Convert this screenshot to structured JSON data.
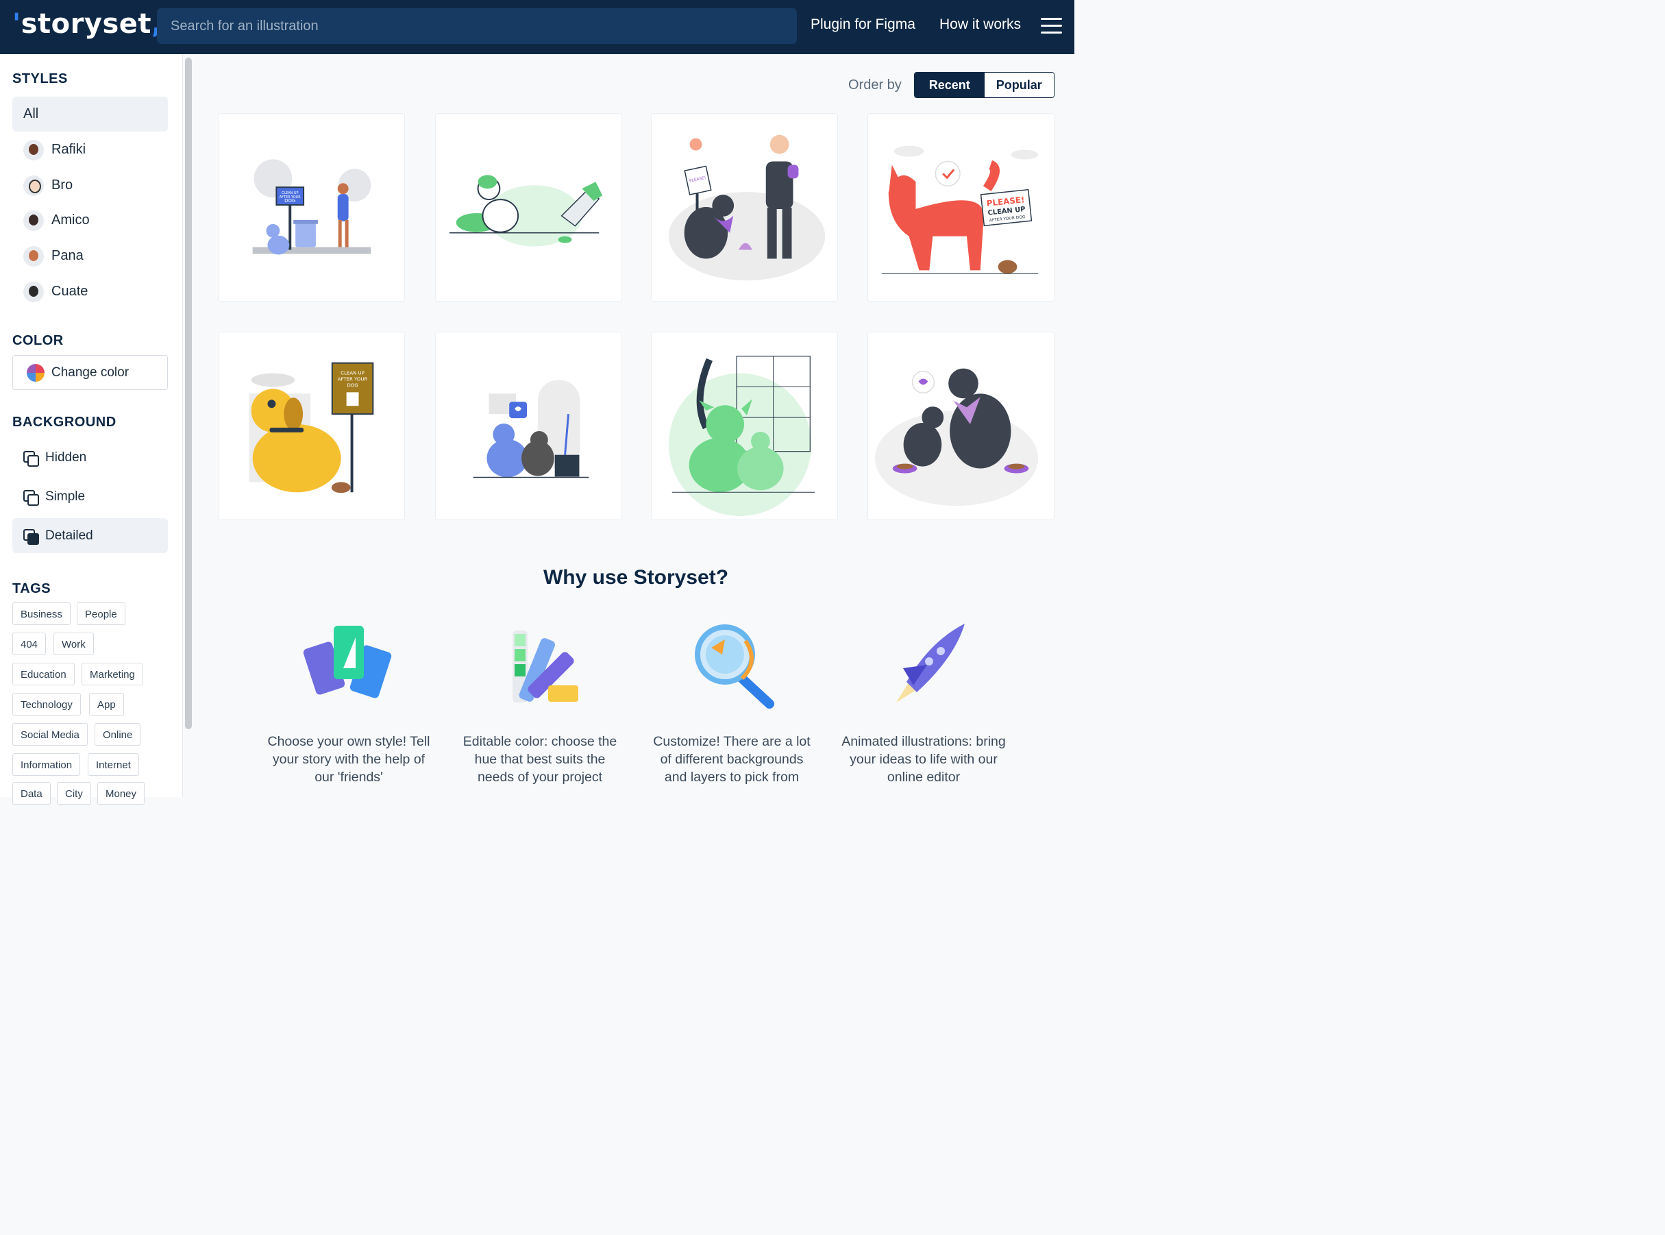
{
  "header": {
    "logo": "storyset",
    "search_placeholder": "Search for an illustration",
    "nav": [
      "Plugin for Figma",
      "How it works"
    ],
    "menu_icon": "hamburger-icon"
  },
  "sidebar": {
    "styles_title": "STYLES",
    "styles": [
      {
        "label": "All",
        "active": true
      },
      {
        "label": "Rafiki",
        "icon": "rafiki-avatar"
      },
      {
        "label": "Bro",
        "icon": "bro-avatar"
      },
      {
        "label": "Amico",
        "icon": "amico-avatar"
      },
      {
        "label": "Pana",
        "icon": "pana-avatar"
      },
      {
        "label": "Cuate",
        "icon": "cuate-avatar"
      }
    ],
    "color_title": "COLOR",
    "change_color": "Change color",
    "background_title": "BACKGROUND",
    "backgrounds": [
      {
        "label": "Hidden"
      },
      {
        "label": "Simple"
      },
      {
        "label": "Detailed",
        "active": true
      }
    ],
    "tags_title": "TAGS",
    "tags": [
      "Business",
      "People",
      "404",
      "Work",
      "Education",
      "Marketing",
      "Technology",
      "App",
      "Social Media",
      "Online",
      "Information",
      "Internet",
      "Data",
      "City",
      "Money"
    ]
  },
  "main": {
    "order_label": "Order by",
    "order_options": [
      {
        "label": "Recent",
        "active": true
      },
      {
        "label": "Popular"
      }
    ],
    "illustrations": [
      {
        "sign": [
          "CLEAN UP",
          "AFTER YOUR",
          "DOG"
        ],
        "accent": "#4a6ee0"
      },
      {
        "accent": "#5ecb7a"
      },
      {
        "sign": [
          "PLEASE!",
          "CLEAN UP",
          "AFTER YOUR DOG"
        ],
        "accent": "#9b5fd6"
      },
      {
        "sign": [
          "PLEASE!",
          "CLEAN UP",
          "AFTER YOUR DOG"
        ],
        "accent": "#f0574a"
      },
      {
        "sign": [
          "CLEAN UP",
          "AFTER YOUR",
          "DOG"
        ],
        "accent": "#f5c02f"
      },
      {
        "accent": "#4a6ee0"
      },
      {
        "accent": "#6fd88a"
      },
      {
        "accent": "#9b5fd6"
      }
    ],
    "why_title": "Why use Storyset?",
    "features": [
      {
        "text": "Choose your own style! Tell your story with the help of our 'friends'",
        "icon": "style-cards-icon"
      },
      {
        "text": "Editable color: choose the hue that best suits the needs of your project",
        "icon": "color-palette-icon"
      },
      {
        "text": "Customize! There are a lot of different backgrounds and layers to pick from",
        "icon": "magnifier-icon"
      },
      {
        "text": "Animated illustrations: bring your ideas to life with our online editor",
        "icon": "rocket-icon"
      }
    ]
  }
}
